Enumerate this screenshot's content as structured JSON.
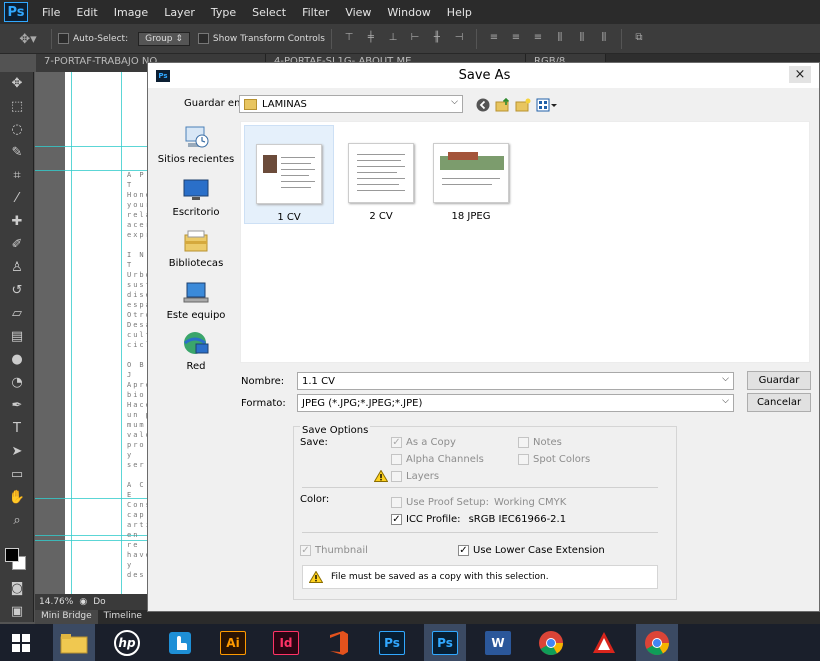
{
  "app": {
    "logo": "Ps",
    "menu": [
      "File",
      "Edit",
      "Image",
      "Layer",
      "Type",
      "Select",
      "Filter",
      "View",
      "Window",
      "Help"
    ]
  },
  "options_bar": {
    "auto_select_label": "Auto-Select:",
    "auto_select_value": "Group",
    "transform_label": "Show Transform Controls"
  },
  "document_tabs": [
    "7-PORTAF-TRABAJO NO",
    "4-PORTAF-SL1G- ABOUT ME",
    "RGB/8"
  ],
  "canvas": {
    "page_text": [
      "A P T",
      "Hone",
      "your",
      "rela",
      "acer",
      "expre",
      "",
      "I N T",
      "Urbo",
      "suste",
      "diseñ",
      "espa",
      "Otro",
      "Desa",
      "cult",
      "ciclis",
      "",
      "O B J",
      "Apre",
      "bio",
      "Hace",
      "un p",
      "mum",
      "valo",
      "pro",
      "y ser",
      "",
      "A C E",
      "Cons",
      "cap",
      "artist",
      "en re",
      "have",
      "y des"
    ]
  },
  "status_bar": {
    "zoom": "14.76%",
    "doc_info": "Do"
  },
  "bottom_tabs": [
    "Mini Bridge",
    "Timeline"
  ],
  "dialog": {
    "title": "Save As",
    "close_glyph": "×",
    "save_in_label": "Guardar en:",
    "save_in_value": "LAMINAS",
    "places": [
      {
        "label": "Sitios recientes",
        "icon": "recent-places-icon"
      },
      {
        "label": "Escritorio",
        "icon": "desktop-icon"
      },
      {
        "label": "Bibliotecas",
        "icon": "libraries-icon"
      },
      {
        "label": "Este equipo",
        "icon": "this-pc-icon"
      },
      {
        "label": "Red",
        "icon": "network-icon"
      }
    ],
    "files": [
      {
        "name": "1 CV",
        "selected": true
      },
      {
        "name": "2 CV",
        "selected": false
      },
      {
        "name": "18 JPEG",
        "selected": false
      }
    ],
    "name_label": "Nombre:",
    "name_value": "1.1 CV",
    "format_label": "Formato:",
    "format_value": "JPEG (*.JPG;*.JPEG;*.JPE)",
    "save_button": "Guardar",
    "cancel_button": "Cancelar",
    "save_options": {
      "heading": "Save Options",
      "save_label": "Save:",
      "as_a_copy": {
        "label": "As a Copy",
        "checked": true,
        "enabled": false
      },
      "notes": {
        "label": "Notes",
        "checked": false,
        "enabled": false
      },
      "alpha_channels": {
        "label": "Alpha Channels",
        "checked": false,
        "enabled": false
      },
      "spot_colors": {
        "label": "Spot Colors",
        "checked": false,
        "enabled": false
      },
      "layers": {
        "label": "Layers",
        "checked": false,
        "enabled": false
      },
      "color_label": "Color:",
      "use_proof_setup": {
        "label": "Use Proof Setup:",
        "value": "Working CMYK",
        "checked": false,
        "enabled": false
      },
      "icc_profile": {
        "label": "ICC Profile:",
        "value": "sRGB IEC61966-2.1",
        "checked": true,
        "enabled": true
      },
      "thumbnail": {
        "label": "Thumbnail",
        "checked": true,
        "enabled": false
      },
      "lower_case_ext": {
        "label": "Use Lower Case Extension",
        "checked": true,
        "enabled": true
      },
      "warning": "File must be saved as a copy with this selection."
    }
  },
  "taskbar": {
    "apps": [
      {
        "name": "file-explorer",
        "label": ""
      },
      {
        "name": "hp",
        "label": "hp"
      },
      {
        "name": "touch",
        "label": ""
      },
      {
        "name": "illustrator",
        "label": "Ai"
      },
      {
        "name": "indesign",
        "label": "Id"
      },
      {
        "name": "office",
        "label": ""
      },
      {
        "name": "photoshop",
        "label": "Ps"
      },
      {
        "name": "photoshop-2",
        "label": "Ps"
      },
      {
        "name": "word",
        "label": "W"
      },
      {
        "name": "chrome",
        "label": ""
      },
      {
        "name": "acrobat",
        "label": ""
      },
      {
        "name": "chrome-2",
        "label": ""
      }
    ]
  },
  "colors": {
    "ps_blue": "#31a8ff",
    "ai_orange": "#ff9a00",
    "id_pink": "#ff3366",
    "word_blue": "#2b579a",
    "guide_cyan": "#33cccc"
  }
}
